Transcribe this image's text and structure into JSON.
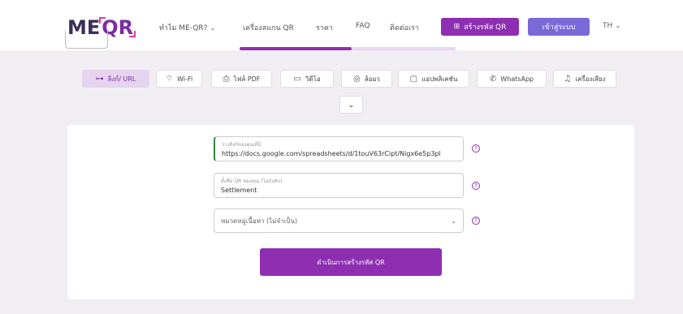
{
  "header": {
    "logo_me": "ME",
    "logo_qr": "QR",
    "nav": [
      {
        "label": "ทำไม ME-QR?",
        "has_dropdown": true
      },
      {
        "label": "เครื่องสแกน QR",
        "has_dropdown": false
      },
      {
        "label": "ราคา",
        "has_dropdown": false
      },
      {
        "label": "FAQ",
        "has_dropdown": false
      },
      {
        "label": "ติดต่อเรา",
        "has_dropdown": false
      }
    ],
    "create_button": "สร้างรหัส QR",
    "login_button": "เข้าสู่ระบบ",
    "language": "TH",
    "accent_color": "#8e2fb2",
    "login_color": "#7a6ad8"
  },
  "type_tabs": [
    {
      "label": "ลิงก์/ URL",
      "icon": "link-icon",
      "active": true
    },
    {
      "label": "Wi-Fi",
      "icon": "wifi-icon",
      "active": false
    },
    {
      "label": "ไฟล์ PDF",
      "icon": "pdf-file-icon",
      "active": false
    },
    {
      "label": "วิดีโอ",
      "icon": "video-icon",
      "active": false
    },
    {
      "label": "ล้อมร",
      "icon": "bullseye-icon",
      "active": false
    },
    {
      "label": "แอปพลิเคชัน",
      "icon": "app-icon",
      "active": false
    },
    {
      "label": "WhatsApp",
      "icon": "whatsapp-icon",
      "active": false
    },
    {
      "label": "เครื่องเสียง",
      "icon": "music-note-icon",
      "active": false
    }
  ],
  "more_button_icon": "chevron-down-icon",
  "form": {
    "url_label": "วางลิงก์ของคุณที่นี่",
    "url_value": "https://docs.google.com/spreadsheets/d/1touV63rCipt/Nigx6e5p3pl",
    "name_label": "ตั้งชื่อ QR ของคุณ (ไม่บังคับ)",
    "name_value": "Settlement",
    "folder_placeholder": "หมวดหมู่เนื้อหา (ไม่จำเป็น)",
    "help_symbol": "?",
    "submit_label": "ดำเนินการสร้างรหัส QR"
  }
}
